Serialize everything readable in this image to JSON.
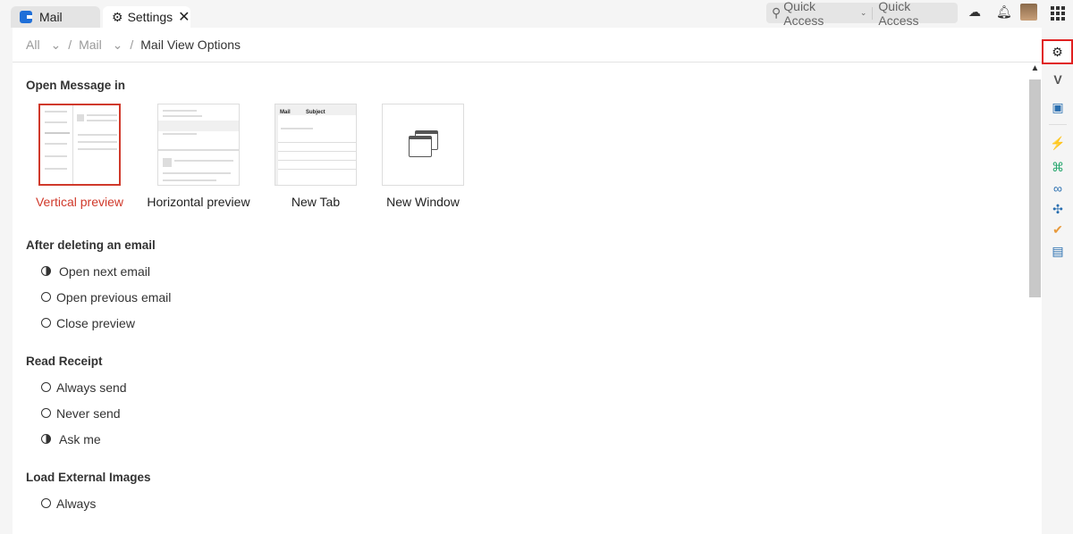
{
  "tabs": [
    {
      "label": "Mail"
    },
    {
      "label": "Settings"
    }
  ],
  "quick_access": {
    "dropdown_label": "Quick Access",
    "input_label": "Quick Access"
  },
  "breadcrumb": [
    "All",
    "Mail",
    "Mail View Options"
  ],
  "sections": {
    "open_message": {
      "title": "Open Message in",
      "options": [
        "Vertical preview",
        "Horizontal preview",
        "New Tab",
        "New Window"
      ],
      "selected": "Vertical preview",
      "newtab_thumb": {
        "tab1": "Mail",
        "tab2": "Subject"
      }
    },
    "after_delete": {
      "title": "After deleting an email",
      "options": [
        "Open next email",
        "Open previous email",
        "Close preview"
      ],
      "selected": 0
    },
    "read_receipt": {
      "title": "Read Receipt",
      "options": [
        "Always send",
        "Never send",
        "Ask me"
      ],
      "selected": 2
    },
    "external_images": {
      "title": "Load External Images",
      "options": [
        "Always"
      ]
    }
  },
  "colors": {
    "accent": "#d0392b"
  }
}
